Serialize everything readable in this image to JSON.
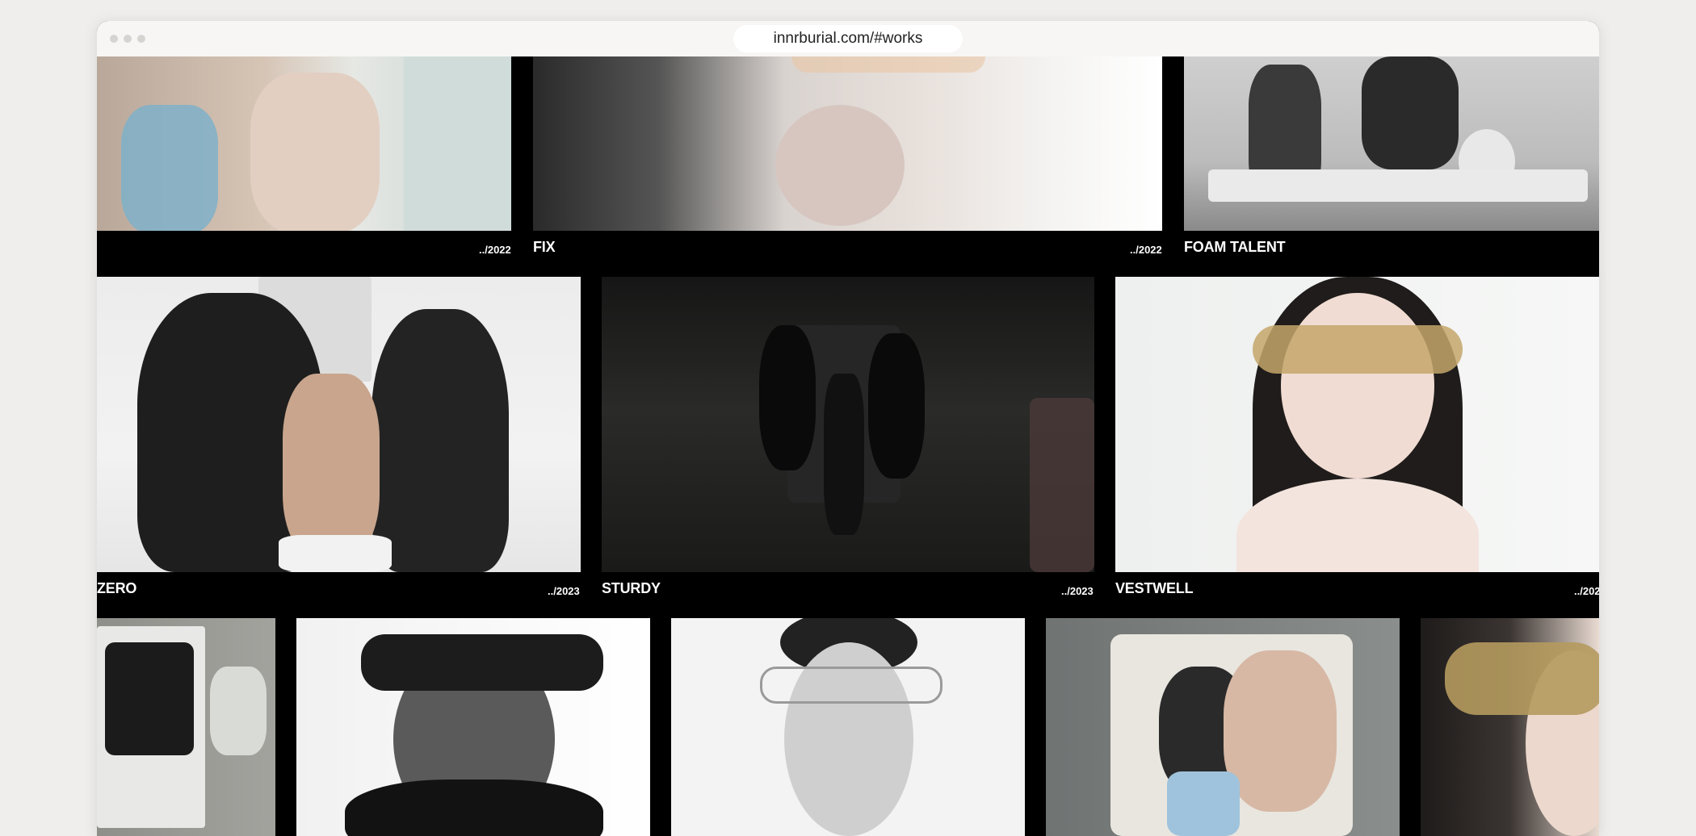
{
  "browser": {
    "url": "innrburial.com/#works"
  },
  "works": {
    "row1": [
      {
        "title": "",
        "year": "../2022"
      },
      {
        "title": "FIX",
        "year": "../2022"
      },
      {
        "title": "FOAM TALENT",
        "year": ""
      }
    ],
    "row2": [
      {
        "title": "ZERO",
        "year": "../2023"
      },
      {
        "title": "STURDY",
        "year": "../2023"
      },
      {
        "title": "VESTWELL",
        "year": "../202"
      }
    ]
  },
  "colors": {
    "page_background": "#efeeec",
    "grid_background": "#000000",
    "text": "#ffffff"
  }
}
